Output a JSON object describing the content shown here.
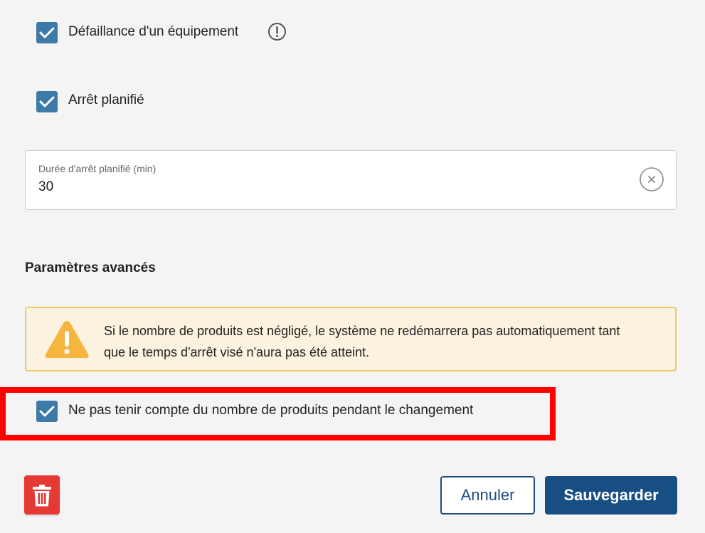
{
  "options": {
    "equipment_failure": {
      "label": "Défaillance d'un équipement",
      "checked": true,
      "info_icon": "info-circle-icon"
    },
    "planned_stop": {
      "label": "Arrêt planifié",
      "checked": true
    }
  },
  "duration_field": {
    "label": "Durée d'arrêt planifié (min)",
    "value": "30",
    "clear_icon": "clear-circle-icon"
  },
  "advanced": {
    "title": "Paramètres avancés",
    "warning": {
      "icon": "warning-triangle-icon",
      "text": "Si le nombre de produits est négligé, le système ne redémarrera pas automatiquement tant que le temps d'arrêt visé n'aura pas été atteint."
    },
    "ignore_count": {
      "label": "Ne pas tenir compte du nombre de produits pendant le changement",
      "checked": true
    }
  },
  "actions": {
    "delete_icon": "trash-icon",
    "cancel_label": "Annuler",
    "save_label": "Sauvegarder"
  },
  "colors": {
    "checkbox": "#3d7aa7",
    "primary": "#174e84",
    "warning_bg": "#fbf2df",
    "warning_border": "#f2c869",
    "warning_icon": "#f6b53c",
    "danger": "#e53935",
    "highlight": "#ff0000"
  }
}
